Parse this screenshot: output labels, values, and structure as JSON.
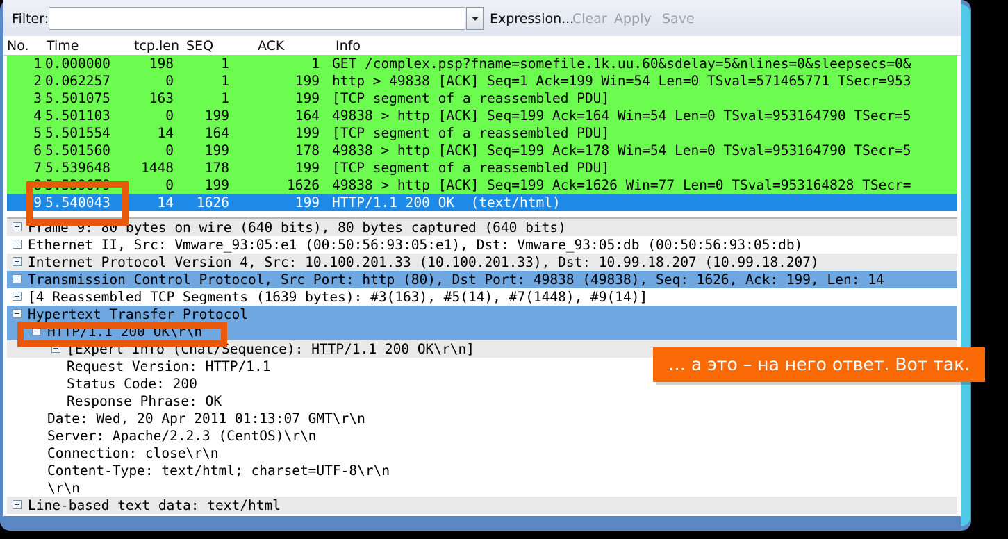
{
  "window": {
    "frame_color": "#5b87c4",
    "accent_color": "#f96a07"
  },
  "filter_bar": {
    "label": "Filter:",
    "value": "",
    "placeholder": "",
    "dropdown_icon": "chevron-down-icon",
    "buttons": [
      {
        "label": "Expression...",
        "enabled": true
      },
      {
        "label": "Clear",
        "enabled": false
      },
      {
        "label": "Apply",
        "enabled": false
      },
      {
        "label": "Save",
        "enabled": false
      }
    ]
  },
  "packet_list": {
    "columns": [
      "No.",
      "Time",
      "tcp.len",
      "SEQ",
      "ACK",
      "Info"
    ],
    "rows": [
      {
        "no": "1",
        "time": "0.000000",
        "len": "198",
        "seq": "1",
        "ack": "1",
        "info": "GET /complex.psp?fname=somefile.1k.uu.60&sdelay=5&nlines=0&sleepsecs=0&",
        "state": "green"
      },
      {
        "no": "2",
        "time": "0.062257",
        "len": "0",
        "seq": "1",
        "ack": "199",
        "info": "http > 49838 [ACK] Seq=1 Ack=199 Win=54 Len=0 TSval=571465771 TSecr=953",
        "state": "green"
      },
      {
        "no": "3",
        "time": "5.501075",
        "len": "163",
        "seq": "1",
        "ack": "199",
        "info": "[TCP segment of a reassembled PDU]",
        "state": "green"
      },
      {
        "no": "4",
        "time": "5.501103",
        "len": "0",
        "seq": "199",
        "ack": "164",
        "info": "49838 > http [ACK] Seq=199 Ack=164 Win=54 Len=0 TSval=953164790 TSecr=5",
        "state": "green"
      },
      {
        "no": "5",
        "time": "5.501554",
        "len": "14",
        "seq": "164",
        "ack": "199",
        "info": "[TCP segment of a reassembled PDU]",
        "state": "green"
      },
      {
        "no": "6",
        "time": "5.501560",
        "len": "0",
        "seq": "199",
        "ack": "178",
        "info": "49838 > http [ACK] Seq=199 Ack=178 Win=54 Len=0 TSval=953164790 TSecr=5",
        "state": "green"
      },
      {
        "no": "7",
        "time": "5.539648",
        "len": "1448",
        "seq": "178",
        "ack": "199",
        "info": "[TCP segment of a reassembled PDU]",
        "state": "green"
      },
      {
        "no": "8",
        "time": "5.539679",
        "len": "0",
        "seq": "199",
        "ack": "1626",
        "info": "49838 > http [ACK] Seq=199 Ack=1626 Win=77 Len=0 TSval=953164828 TSecr=",
        "state": "green"
      },
      {
        "no": "9",
        "time": "5.540043",
        "len": "14",
        "seq": "1626",
        "ack": "199",
        "info": "HTTP/1.1 200 OK  (text/html)",
        "state": "selected"
      }
    ]
  },
  "detail_tree": [
    {
      "text": "Frame 9: 80 bytes on wire (640 bits), 80 bytes captured (640 bits)",
      "indent": 0,
      "twisty": "plus",
      "bg": "grey"
    },
    {
      "text": "Ethernet II, Src: Vmware_93:05:e1 (00:50:56:93:05:e1), Dst: Vmware_93:05:db (00:50:56:93:05:db)",
      "indent": 0,
      "twisty": "plus",
      "bg": "white"
    },
    {
      "text": "Internet Protocol Version 4, Src: 10.100.201.33 (10.100.201.33), Dst: 10.99.18.207 (10.99.18.207)",
      "indent": 0,
      "twisty": "plus",
      "bg": "grey"
    },
    {
      "text": "Transmission Control Protocol, Src Port: http (80), Dst Port: 49838 (49838), Seq: 1626, Ack: 199, Len: 14",
      "indent": 0,
      "twisty": "plus",
      "bg": "blue"
    },
    {
      "text": "[4 Reassembled TCP Segments (1639 bytes): #3(163), #5(14), #7(1448), #9(14)]",
      "indent": 0,
      "twisty": "plus",
      "bg": "white"
    },
    {
      "text": "Hypertext Transfer Protocol",
      "indent": 0,
      "twisty": "minus",
      "bg": "blue"
    },
    {
      "text": "HTTP/1.1 200 OK\\r\\n",
      "indent": 1,
      "twisty": "minus",
      "bg": "blue"
    },
    {
      "text": "[Expert Info (Chat/Sequence): HTTP/1.1 200 OK\\r\\n]",
      "indent": 2,
      "twisty": "plus",
      "bg": "grey"
    },
    {
      "text": "Request Version: HTTP/1.1",
      "indent": 2,
      "twisty": "none",
      "bg": "white"
    },
    {
      "text": "Status Code: 200",
      "indent": 2,
      "twisty": "none",
      "bg": "white"
    },
    {
      "text": "Response Phrase: OK",
      "indent": 2,
      "twisty": "none",
      "bg": "white"
    },
    {
      "text": "Date: Wed, 20 Apr 2011 01:13:07 GMT\\r\\n",
      "indent": 1,
      "twisty": "none",
      "bg": "white"
    },
    {
      "text": "Server: Apache/2.2.3 (CentOS)\\r\\n",
      "indent": 1,
      "twisty": "none",
      "bg": "white"
    },
    {
      "text": "Connection: close\\r\\n",
      "indent": 1,
      "twisty": "none",
      "bg": "white"
    },
    {
      "text": "Content-Type: text/html; charset=UTF-8\\r\\n",
      "indent": 1,
      "twisty": "none",
      "bg": "white"
    },
    {
      "text": "\\r\\n",
      "indent": 1,
      "twisty": "none",
      "bg": "white"
    },
    {
      "text": "Line-based text data: text/html",
      "indent": 0,
      "twisty": "plus",
      "bg": "grey"
    }
  ],
  "annotations": {
    "highlight_boxes": [
      {
        "name": "selected-packet-highlight"
      },
      {
        "name": "http-status-line-highlight"
      }
    ],
    "callout": {
      "text": "… а это – на него ответ. Вот так."
    }
  }
}
